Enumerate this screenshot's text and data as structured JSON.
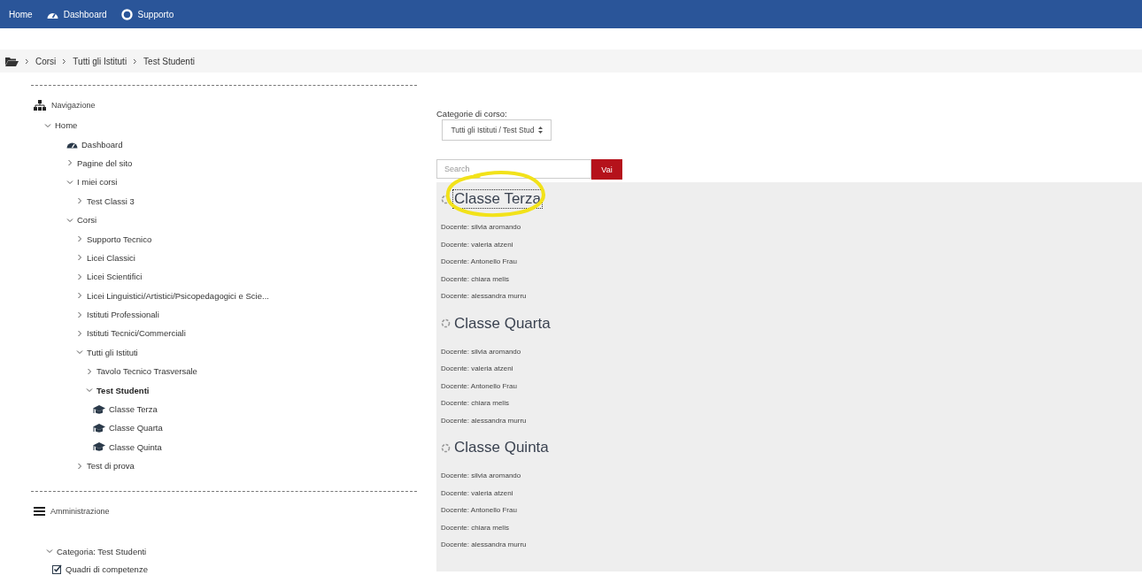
{
  "topbar": {
    "items": [
      {
        "label": "Home",
        "kind": "text"
      },
      {
        "label": "Dashboard",
        "kind": "dashboard"
      },
      {
        "label": "Supporto",
        "kind": "support"
      }
    ]
  },
  "breadcrumb": [
    "Corsi",
    "Tutti gli Istituti",
    "Test Studenti"
  ],
  "navigation": {
    "title": "Navigazione",
    "tree": [
      {
        "label": "Home",
        "kind": "branch",
        "expanded": true,
        "children": [
          {
            "label": "Dashboard",
            "kind": "dashboard"
          },
          {
            "label": "Pagine del sito",
            "kind": "branch",
            "expanded": false
          },
          {
            "label": "I miei corsi",
            "kind": "branch",
            "expanded": true,
            "children": [
              {
                "label": "Test Classi 3",
                "kind": "branch",
                "expanded": false
              }
            ]
          },
          {
            "label": "Corsi",
            "kind": "branch",
            "expanded": true,
            "children": [
              {
                "label": "Supporto Tecnico",
                "kind": "branch",
                "expanded": false
              },
              {
                "label": "Licei Classici",
                "kind": "branch",
                "expanded": false
              },
              {
                "label": "Licei Scientifici",
                "kind": "branch",
                "expanded": false
              },
              {
                "label": "Licei Linguistici/Artistici/Psicopedagogici e Scie...",
                "kind": "branch",
                "expanded": false
              },
              {
                "label": "Istituti Professionali",
                "kind": "branch",
                "expanded": false
              },
              {
                "label": "Istituti Tecnici/Commerciali",
                "kind": "branch",
                "expanded": false
              },
              {
                "label": "Tutti gli Istituti",
                "kind": "branch",
                "expanded": true,
                "children": [
                  {
                    "label": "Tavolo Tecnico Trasversale",
                    "kind": "branch",
                    "expanded": false
                  },
                  {
                    "label": "Test Studenti",
                    "kind": "branch",
                    "expanded": true,
                    "current": true,
                    "children": [
                      {
                        "label": "Classe Terza",
                        "kind": "course"
                      },
                      {
                        "label": "Classe Quarta",
                        "kind": "course"
                      },
                      {
                        "label": "Classe Quinta",
                        "kind": "course"
                      }
                    ]
                  }
                ]
              },
              {
                "label": "Test di prova",
                "kind": "branch",
                "expanded": false
              }
            ]
          }
        ]
      }
    ]
  },
  "administration": {
    "title": "Amministrazione",
    "tree": [
      {
        "label": "Categoria: Test Studenti",
        "kind": "branch",
        "expanded": true,
        "children": [
          {
            "label": "Quadri di competenze",
            "kind": "checkbox"
          }
        ]
      }
    ]
  },
  "category_select": {
    "label": "Categorie di corso:",
    "value": "Tutti gli Istituti / Test Stud"
  },
  "search": {
    "placeholder": "Search",
    "button": "Vai"
  },
  "courses": [
    {
      "title": "Classe Terza",
      "focused": true,
      "teachers": [
        "Docente: silvia aromando",
        "Docente: valeria atzeni",
        "Docente: Antonello Frau",
        "Docente: chiara melis",
        "Docente: alessandra murru"
      ]
    },
    {
      "title": "Classe Quarta",
      "focused": false,
      "teachers": [
        "Docente: silvia aromando",
        "Docente: valeria atzeni",
        "Docente: Antonello Frau",
        "Docente: chiara melis",
        "Docente: alessandra murru"
      ]
    },
    {
      "title": "Classe Quinta",
      "focused": false,
      "teachers": [
        "Docente: silvia aromando",
        "Docente: valeria atzeni",
        "Docente: Antonello Frau",
        "Docente: chiara melis",
        "Docente: alessandra murru"
      ]
    }
  ]
}
